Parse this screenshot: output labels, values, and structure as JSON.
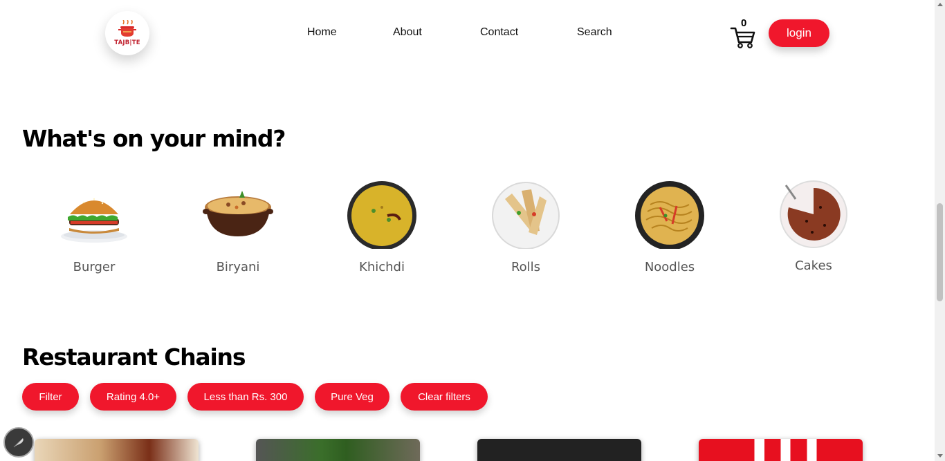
{
  "header": {
    "logo_text": "TAJB|TE",
    "nav": [
      "Home",
      "About",
      "Contact",
      "Search"
    ],
    "cart_count": "0",
    "login_label": "login"
  },
  "section_mind": {
    "title": "What's on your mind?",
    "categories": [
      {
        "label": "Burger",
        "icon": "burger-icon"
      },
      {
        "label": "Biryani",
        "icon": "biryani-icon"
      },
      {
        "label": "Khichdi",
        "icon": "khichdi-icon"
      },
      {
        "label": "Rolls",
        "icon": "rolls-icon"
      },
      {
        "label": "Noodles",
        "icon": "noodles-icon"
      },
      {
        "label": "Cakes",
        "icon": "cake-icon"
      }
    ]
  },
  "section_chains": {
    "title": "Restaurant Chains",
    "filters": [
      "Filter",
      "Rating 4.0+",
      "Less than Rs. 300",
      "Pure Veg",
      "Clear filters"
    ]
  },
  "colors": {
    "accent": "#f0172c",
    "text": "#000000",
    "muted": "#555555"
  }
}
